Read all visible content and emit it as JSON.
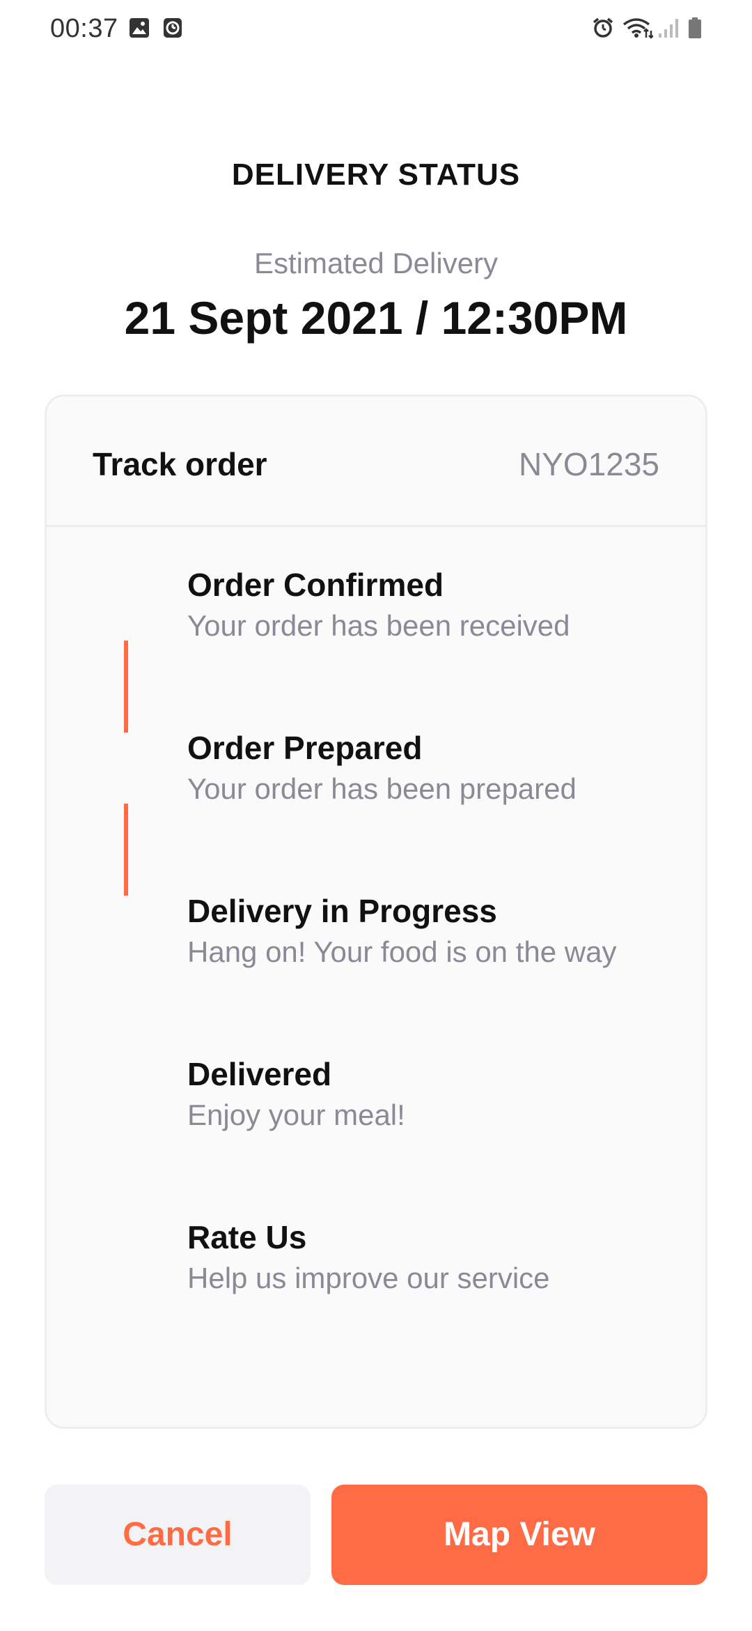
{
  "status_bar": {
    "time": "00:37"
  },
  "header": {
    "title": "DELIVERY STATUS",
    "eta_label": "Estimated Delivery",
    "eta_value": "21 Sept 2021 / 12:30PM"
  },
  "track": {
    "title": "Track order",
    "order_id": "NYO1235",
    "steps": [
      {
        "title": "Order Confirmed",
        "desc": "Your order has been received"
      },
      {
        "title": "Order Prepared",
        "desc": "Your order has been prepared"
      },
      {
        "title": "Delivery in Progress",
        "desc": "Hang on! Your food is on the way"
      },
      {
        "title": "Delivered",
        "desc": "Enjoy your meal!"
      },
      {
        "title": "Rate Us",
        "desc": "Help us improve our service"
      }
    ]
  },
  "actions": {
    "cancel_label": "Cancel",
    "map_label": "Map View"
  },
  "colors": {
    "accent": "#ff6b45",
    "muted_text": "#8a8a96",
    "card_bg": "#fafafa",
    "cancel_bg": "#f3f3f5"
  },
  "icons": {
    "status_left": [
      "image-icon",
      "clock-app-icon"
    ],
    "status_right": [
      "alarm-icon",
      "wifi-icon",
      "signal-icon",
      "battery-icon"
    ]
  }
}
